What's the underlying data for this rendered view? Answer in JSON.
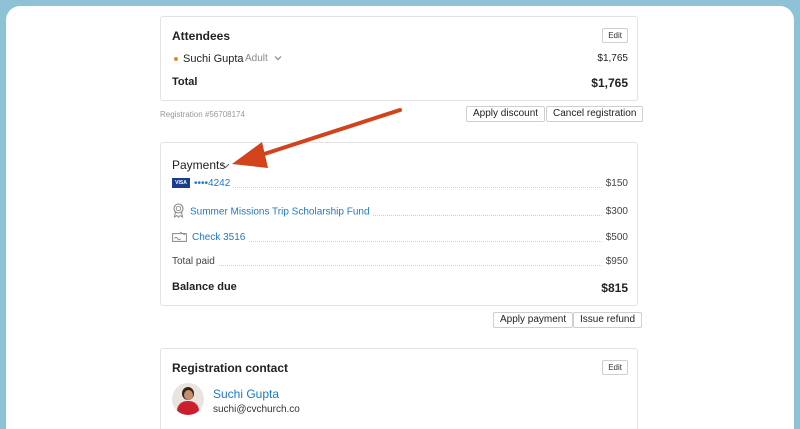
{
  "colors": {
    "accent_link": "#1c7ac9",
    "arrow": "#d2431c",
    "border": "#e3e3e3",
    "frame": "#8ec2d6"
  },
  "attendees": {
    "title": "Attendees",
    "edit_label": "Edit",
    "attendee_name": "Suchi Gupta",
    "attendee_type": "Adult",
    "attendee_amount": "$1,765",
    "total_label": "Total",
    "total_amount": "$1,765"
  },
  "registration": {
    "number": "Registration #56708174",
    "apply_discount_label": "Apply discount",
    "cancel_label": "Cancel registration"
  },
  "payments": {
    "title": "Payments",
    "items": [
      {
        "icon": "visa-card-icon",
        "label": "••••4242",
        "amount": "$150"
      },
      {
        "icon": "award-ribbon-icon",
        "label": "Summer Missions Trip Scholarship Fund",
        "amount": "$300"
      },
      {
        "icon": "check-icon",
        "label": "Check 3516",
        "amount": "$500"
      }
    ],
    "visa_text": "VISA",
    "total_paid_label": "Total paid",
    "total_paid_amount": "$950",
    "balance_due_label": "Balance due",
    "balance_due_amount": "$815",
    "apply_payment_label": "Apply payment",
    "issue_refund_label": "Issue refund"
  },
  "contact": {
    "title": "Registration contact",
    "edit_label": "Edit",
    "name": "Suchi Gupta",
    "email": "suchi@cvchurch.co"
  }
}
